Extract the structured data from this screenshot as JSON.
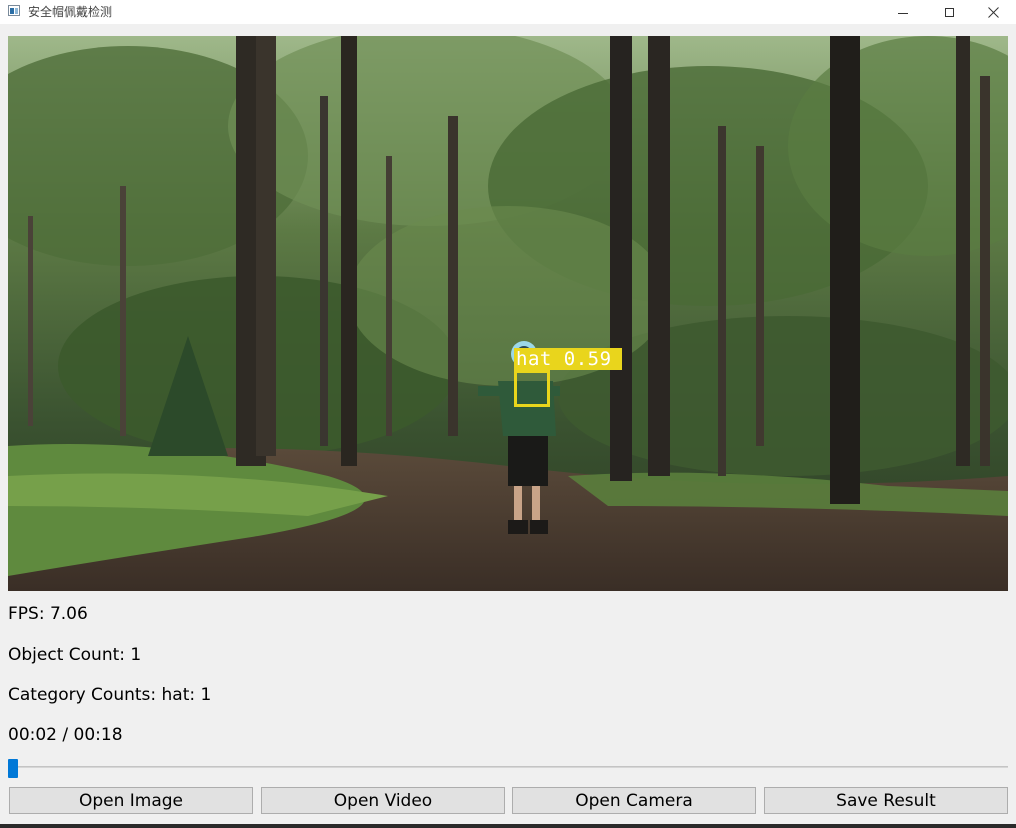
{
  "window": {
    "title": "安全帽佩戴检测"
  },
  "icons": {
    "app": "app-window-icon",
    "minimize": "minimize-icon",
    "maximize": "maximize-icon",
    "close": "close-icon"
  },
  "video": {
    "detection_label": "hat 0.59",
    "detection_color": "#e9d51c"
  },
  "info": {
    "fps": "FPS: 7.06",
    "object_count": "Object Count: 1",
    "category_counts": "Category Counts: hat: 1",
    "time": "00:02 / 00:18"
  },
  "slider": {
    "progress": 0.11,
    "accent": "#0078d7"
  },
  "buttons": {
    "open_image": "Open Image",
    "open_video": "Open Video",
    "open_camera": "Open Camera",
    "save_result": "Save Result"
  }
}
